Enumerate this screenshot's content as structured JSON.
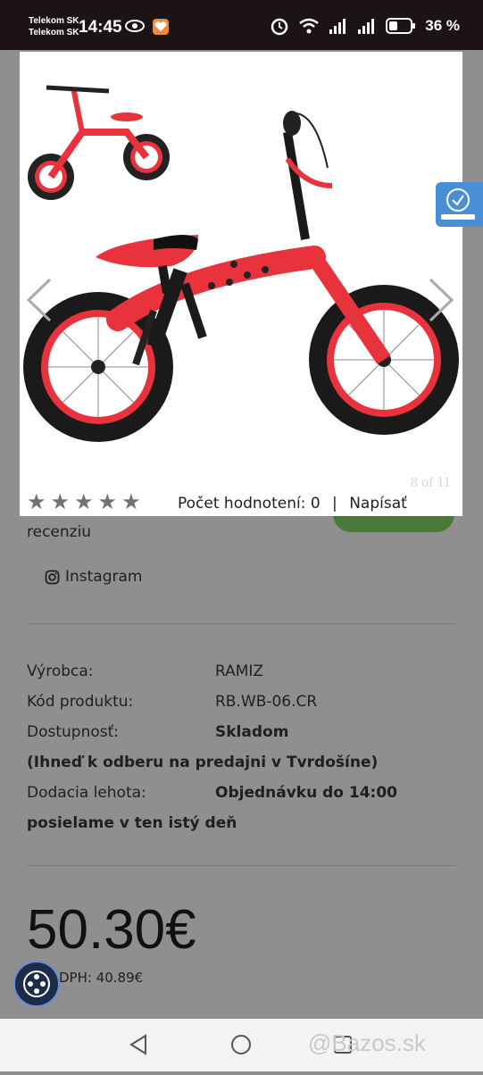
{
  "status_bar": {
    "carrier_1": "Telekom SK",
    "carrier_2": "Telekom SK",
    "time": "14:45",
    "battery": "36 %"
  },
  "gallery": {
    "counter": "8 of 11"
  },
  "rating": {
    "stars_filled": 0,
    "stars_total": 5,
    "count_text": "Počet hodnotení: 0",
    "separator": "|",
    "write_review_1": "Napísať",
    "write_review_2": "recenziu"
  },
  "social": {
    "instagram_label": "Instagram"
  },
  "specs": {
    "manufacturer_label": "Výrobca:",
    "manufacturer_value": "RAMIZ",
    "code_label": "Kód produktu:",
    "code_value": "RB.WB-06.CR",
    "availability_label": "Dostupnosť:",
    "availability_value": "Skladom",
    "availability_note": "(Ihneď k odberu na predajni v Tvrdošíne)",
    "delivery_label": "Dodacia lehota:",
    "delivery_value_1": "Objednávku do 14:00",
    "delivery_value_2": "posielame v ten istý deň"
  },
  "price": {
    "amount": "50.30€",
    "vat_text": "DPH: 40.89€"
  },
  "watermark": "@Bazos.sk",
  "colors": {
    "bike_red": "#e8323c",
    "overlay_gray": "#8f8f8f",
    "green_button": "#4a7a3a"
  }
}
